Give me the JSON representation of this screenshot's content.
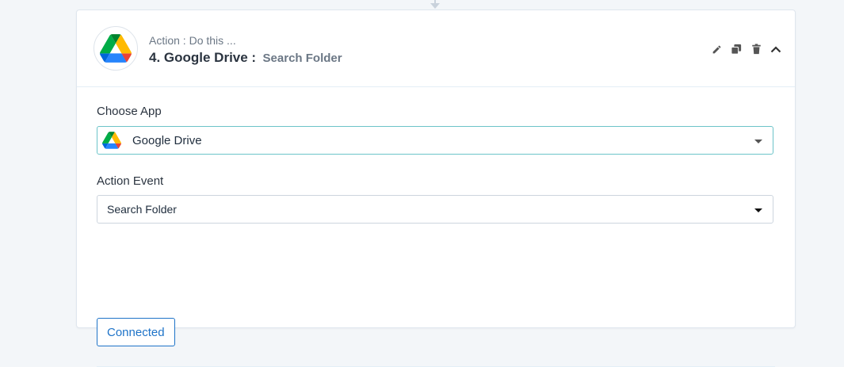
{
  "header": {
    "subtitle": "Action : Do this ...",
    "title_main": "4. Google Drive :",
    "title_event": "Search Folder",
    "icons": [
      "pencil-icon",
      "copy-icon",
      "trash-icon",
      "chevron-up-icon"
    ]
  },
  "form": {
    "choose_app_label": "Choose App",
    "choose_app_value": "Google Drive",
    "action_event_label": "Action Event",
    "action_event_value": "Search Folder",
    "connected_label": "Connected"
  },
  "colors": {
    "accent_blue": "#1e73c8",
    "focus_teal": "#6cc4c9",
    "drive_green": "#0f9d58",
    "drive_yellow": "#f4b400",
    "drive_blue": "#4285f4"
  }
}
